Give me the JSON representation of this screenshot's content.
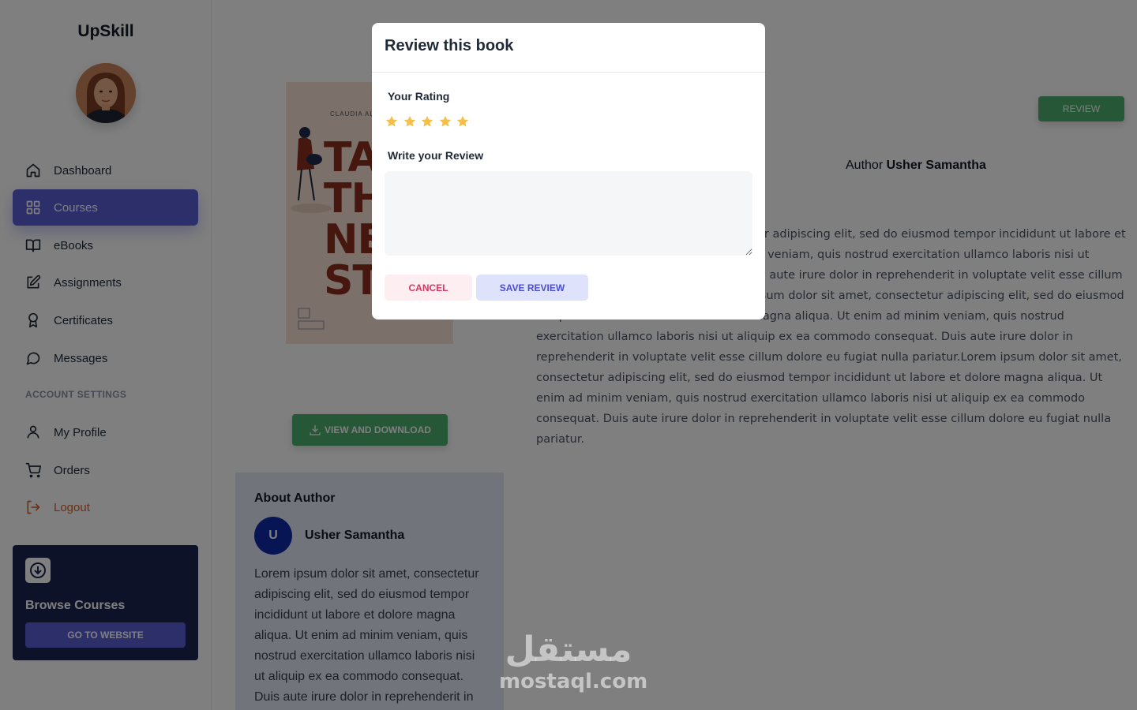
{
  "app": {
    "brand": "UpSkill"
  },
  "sidebar": {
    "items": [
      {
        "label": "Dashboard",
        "icon": "home-icon",
        "active": false
      },
      {
        "label": "Courses",
        "icon": "grid-icon",
        "active": true
      },
      {
        "label": "eBooks",
        "icon": "book-open-icon",
        "active": false
      },
      {
        "label": "Assignments",
        "icon": "edit-icon",
        "active": false
      },
      {
        "label": "Certificates",
        "icon": "award-icon",
        "active": false
      },
      {
        "label": "Messages",
        "icon": "message-icon",
        "active": false
      }
    ],
    "section_title": "ACCOUNT SETTINGS",
    "account_items": [
      {
        "label": "My Profile",
        "icon": "user-icon"
      },
      {
        "label": "Orders",
        "icon": "cart-icon"
      },
      {
        "label": "Logout",
        "icon": "logout-icon"
      }
    ],
    "browse": {
      "title": "Browse Courses",
      "button": "GO TO WEBSITE",
      "icon": "download-circle-icon"
    }
  },
  "book": {
    "cover_author": "CLAUDIA ALV",
    "cover_title_lines": [
      "TA",
      "TH",
      "NE",
      "ST"
    ],
    "download_label": "VIEW AND DOWNLOAD",
    "review_button": "REVIEW",
    "author_prefix": "Author",
    "author_name": "Usher Samantha",
    "description": "Lorem ipsum dolor sit amet, consectetur adipiscing elit, sed do eiusmod tempor incididunt ut labore et dolore magna aliqua. Ut enim ad minim veniam, quis nostrud exercitation ullamco laboris nisi ut aliquip ex ea commodo consequat. Duis aute irure dolor in reprehenderit in voluptate velit esse cillum dolore eu fugiat nulla pariatur.Lorem ipsum dolor sit amet, consectetur adipiscing elit, sed do eiusmod tempor incididunt ut labore et dolore magna aliqua. Ut enim ad minim veniam, quis nostrud exercitation ullamco laboris nisi ut aliquip ex ea commodo consequat. Duis aute irure dolor in reprehenderit in voluptate velit esse cillum dolore eu fugiat nulla pariatur.Lorem ipsum dolor sit amet, consectetur adipiscing elit, sed do eiusmod tempor incididunt ut labore et dolore magna aliqua. Ut enim ad minim veniam, quis nostrud exercitation ullamco laboris nisi ut aliquip ex ea commodo consequat. Duis aute irure dolor in reprehenderit in voluptate velit esse cillum dolore eu fugiat nulla pariatur."
  },
  "about_author": {
    "title": "About Author",
    "initial": "U",
    "name": "Usher Samantha",
    "bio": "Lorem ipsum dolor sit amet, consectetur adipiscing elit, sed do eiusmod tempor incididunt ut labore et dolore magna aliqua. Ut enim ad minim veniam, quis nostrud exercitation ullamco laboris nisi ut aliquip ex ea commodo consequat. Duis aute irure dolor in reprehenderit in"
  },
  "modal": {
    "title": "Review this book",
    "rating_label": "Your Rating",
    "rating": 5,
    "rating_max": 5,
    "review_label": "Write your Review",
    "review_value": "",
    "cancel_label": "CANCEL",
    "save_label": "SAVE REVIEW"
  },
  "watermark": {
    "arabic": "مستقل",
    "latin": "mostaql.com"
  },
  "colors": {
    "primary": "#5b5fd6",
    "success": "#4caf6e",
    "star": "#f5c04a",
    "logout": "#d9602b",
    "card_dark": "#1c2450",
    "author_avatar": "#0f2aa8"
  }
}
